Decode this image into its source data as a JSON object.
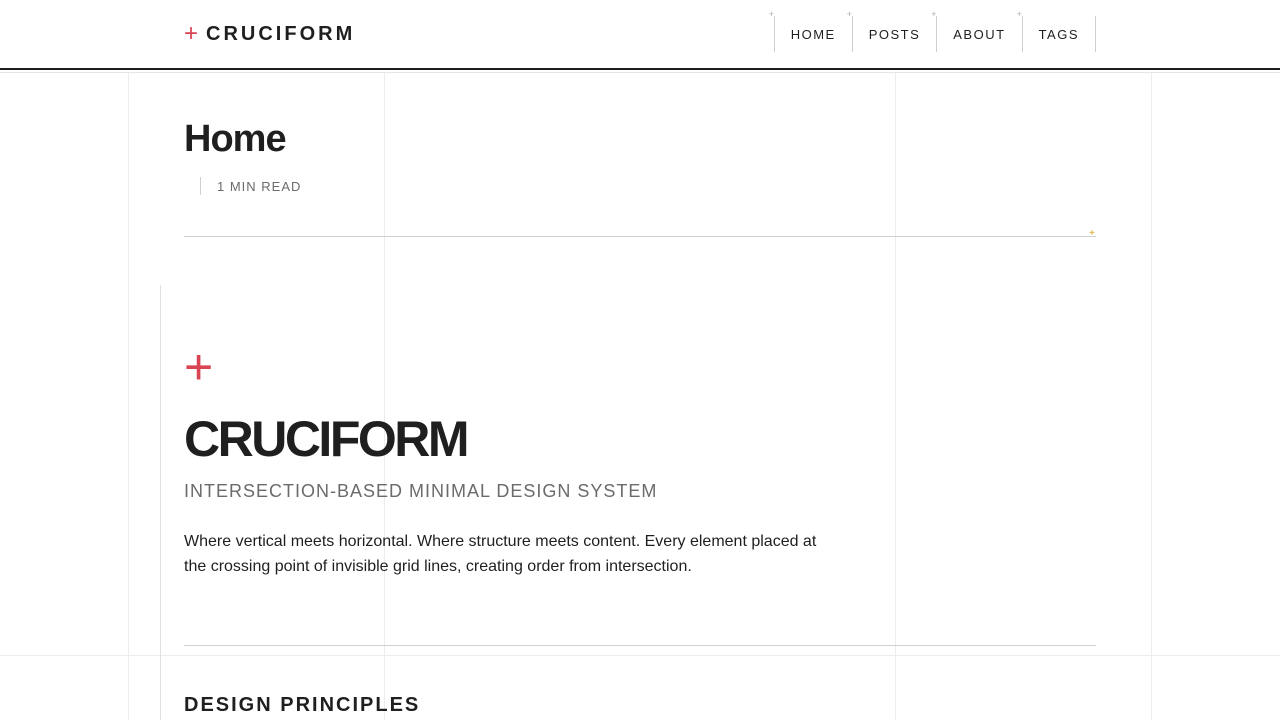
{
  "site": {
    "brand_symbol": "+",
    "brand_name": "CRUCIFORM"
  },
  "nav": {
    "items": [
      {
        "label": "HOME"
      },
      {
        "label": "POSTS"
      },
      {
        "label": "ABOUT"
      },
      {
        "label": "TAGS"
      }
    ],
    "corner_mark": "+"
  },
  "page": {
    "title": "Home",
    "reading_time": "1 MIN READ",
    "divider_mark": "+"
  },
  "hero": {
    "symbol": "+",
    "title": "CRUCIFORM",
    "subtitle": "INTERSECTION-BASED MINIMAL DESIGN SYSTEM",
    "description": "Where vertical meets horizontal. Where structure meets content. Every element placed at the crossing point of invisible grid lines, creating order from intersection."
  },
  "section": {
    "heading": "DESIGN PRINCIPLES"
  },
  "colors": {
    "accent_red": "#d94452",
    "accent_gold": "#d4a017",
    "text_dark": "#1f1f1f",
    "text_muted": "#6b6b6b",
    "grid_line": "#ececec"
  }
}
